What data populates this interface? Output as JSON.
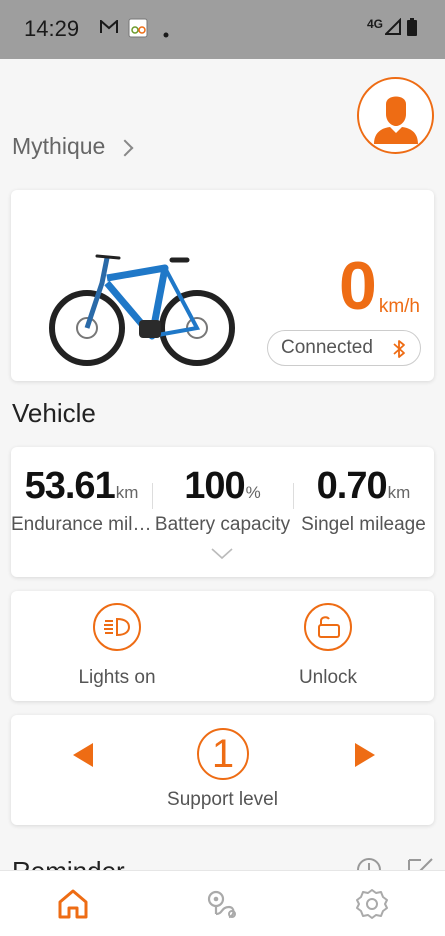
{
  "status_bar": {
    "time": "14:29",
    "network": "4G"
  },
  "header": {
    "bike_name": "Mythique"
  },
  "hero": {
    "speed_value": "0",
    "speed_unit": "km/h",
    "connection_label": "Connected"
  },
  "vehicle": {
    "title": "Vehicle",
    "stats": [
      {
        "value": "53.61",
        "unit": "km",
        "label": "Endurance mileage"
      },
      {
        "value": "100",
        "unit": "%",
        "label": "Battery capacity"
      },
      {
        "value": "0.70",
        "unit": "km",
        "label": "Singel mileage"
      }
    ]
  },
  "controls": {
    "lights_label": "Lights on",
    "unlock_label": "Unlock"
  },
  "support": {
    "level": "1",
    "label": "Support level"
  },
  "reminder": {
    "title": "Reminder"
  },
  "bottom_nav": {
    "items": [
      "home-icon",
      "map-route-icon",
      "settings-icon"
    ]
  },
  "colors": {
    "accent": "#ee6c14",
    "status_bar": "#9e9e9e"
  }
}
